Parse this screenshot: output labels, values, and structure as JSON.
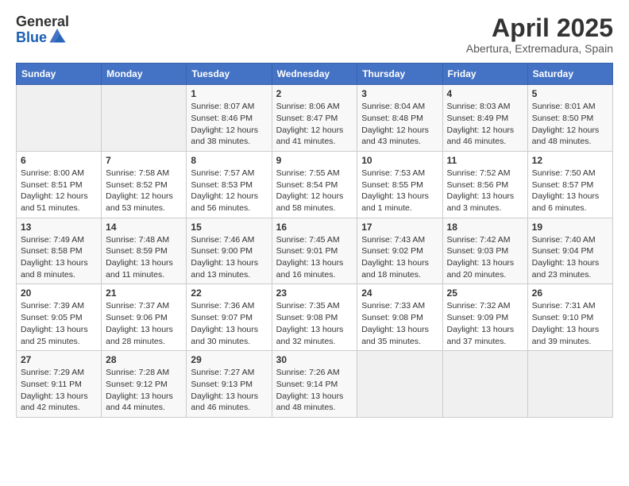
{
  "header": {
    "logo_general": "General",
    "logo_blue": "Blue",
    "month_title": "April 2025",
    "location": "Abertura, Extremadura, Spain"
  },
  "days_of_week": [
    "Sunday",
    "Monday",
    "Tuesday",
    "Wednesday",
    "Thursday",
    "Friday",
    "Saturday"
  ],
  "weeks": [
    [
      {
        "day": "",
        "sunrise": "",
        "sunset": "",
        "daylight": ""
      },
      {
        "day": "",
        "sunrise": "",
        "sunset": "",
        "daylight": ""
      },
      {
        "day": "1",
        "sunrise": "Sunrise: 8:07 AM",
        "sunset": "Sunset: 8:46 PM",
        "daylight": "Daylight: 12 hours and 38 minutes."
      },
      {
        "day": "2",
        "sunrise": "Sunrise: 8:06 AM",
        "sunset": "Sunset: 8:47 PM",
        "daylight": "Daylight: 12 hours and 41 minutes."
      },
      {
        "day": "3",
        "sunrise": "Sunrise: 8:04 AM",
        "sunset": "Sunset: 8:48 PM",
        "daylight": "Daylight: 12 hours and 43 minutes."
      },
      {
        "day": "4",
        "sunrise": "Sunrise: 8:03 AM",
        "sunset": "Sunset: 8:49 PM",
        "daylight": "Daylight: 12 hours and 46 minutes."
      },
      {
        "day": "5",
        "sunrise": "Sunrise: 8:01 AM",
        "sunset": "Sunset: 8:50 PM",
        "daylight": "Daylight: 12 hours and 48 minutes."
      }
    ],
    [
      {
        "day": "6",
        "sunrise": "Sunrise: 8:00 AM",
        "sunset": "Sunset: 8:51 PM",
        "daylight": "Daylight: 12 hours and 51 minutes."
      },
      {
        "day": "7",
        "sunrise": "Sunrise: 7:58 AM",
        "sunset": "Sunset: 8:52 PM",
        "daylight": "Daylight: 12 hours and 53 minutes."
      },
      {
        "day": "8",
        "sunrise": "Sunrise: 7:57 AM",
        "sunset": "Sunset: 8:53 PM",
        "daylight": "Daylight: 12 hours and 56 minutes."
      },
      {
        "day": "9",
        "sunrise": "Sunrise: 7:55 AM",
        "sunset": "Sunset: 8:54 PM",
        "daylight": "Daylight: 12 hours and 58 minutes."
      },
      {
        "day": "10",
        "sunrise": "Sunrise: 7:53 AM",
        "sunset": "Sunset: 8:55 PM",
        "daylight": "Daylight: 13 hours and 1 minute."
      },
      {
        "day": "11",
        "sunrise": "Sunrise: 7:52 AM",
        "sunset": "Sunset: 8:56 PM",
        "daylight": "Daylight: 13 hours and 3 minutes."
      },
      {
        "day": "12",
        "sunrise": "Sunrise: 7:50 AM",
        "sunset": "Sunset: 8:57 PM",
        "daylight": "Daylight: 13 hours and 6 minutes."
      }
    ],
    [
      {
        "day": "13",
        "sunrise": "Sunrise: 7:49 AM",
        "sunset": "Sunset: 8:58 PM",
        "daylight": "Daylight: 13 hours and 8 minutes."
      },
      {
        "day": "14",
        "sunrise": "Sunrise: 7:48 AM",
        "sunset": "Sunset: 8:59 PM",
        "daylight": "Daylight: 13 hours and 11 minutes."
      },
      {
        "day": "15",
        "sunrise": "Sunrise: 7:46 AM",
        "sunset": "Sunset: 9:00 PM",
        "daylight": "Daylight: 13 hours and 13 minutes."
      },
      {
        "day": "16",
        "sunrise": "Sunrise: 7:45 AM",
        "sunset": "Sunset: 9:01 PM",
        "daylight": "Daylight: 13 hours and 16 minutes."
      },
      {
        "day": "17",
        "sunrise": "Sunrise: 7:43 AM",
        "sunset": "Sunset: 9:02 PM",
        "daylight": "Daylight: 13 hours and 18 minutes."
      },
      {
        "day": "18",
        "sunrise": "Sunrise: 7:42 AM",
        "sunset": "Sunset: 9:03 PM",
        "daylight": "Daylight: 13 hours and 20 minutes."
      },
      {
        "day": "19",
        "sunrise": "Sunrise: 7:40 AM",
        "sunset": "Sunset: 9:04 PM",
        "daylight": "Daylight: 13 hours and 23 minutes."
      }
    ],
    [
      {
        "day": "20",
        "sunrise": "Sunrise: 7:39 AM",
        "sunset": "Sunset: 9:05 PM",
        "daylight": "Daylight: 13 hours and 25 minutes."
      },
      {
        "day": "21",
        "sunrise": "Sunrise: 7:37 AM",
        "sunset": "Sunset: 9:06 PM",
        "daylight": "Daylight: 13 hours and 28 minutes."
      },
      {
        "day": "22",
        "sunrise": "Sunrise: 7:36 AM",
        "sunset": "Sunset: 9:07 PM",
        "daylight": "Daylight: 13 hours and 30 minutes."
      },
      {
        "day": "23",
        "sunrise": "Sunrise: 7:35 AM",
        "sunset": "Sunset: 9:08 PM",
        "daylight": "Daylight: 13 hours and 32 minutes."
      },
      {
        "day": "24",
        "sunrise": "Sunrise: 7:33 AM",
        "sunset": "Sunset: 9:08 PM",
        "daylight": "Daylight: 13 hours and 35 minutes."
      },
      {
        "day": "25",
        "sunrise": "Sunrise: 7:32 AM",
        "sunset": "Sunset: 9:09 PM",
        "daylight": "Daylight: 13 hours and 37 minutes."
      },
      {
        "day": "26",
        "sunrise": "Sunrise: 7:31 AM",
        "sunset": "Sunset: 9:10 PM",
        "daylight": "Daylight: 13 hours and 39 minutes."
      }
    ],
    [
      {
        "day": "27",
        "sunrise": "Sunrise: 7:29 AM",
        "sunset": "Sunset: 9:11 PM",
        "daylight": "Daylight: 13 hours and 42 minutes."
      },
      {
        "day": "28",
        "sunrise": "Sunrise: 7:28 AM",
        "sunset": "Sunset: 9:12 PM",
        "daylight": "Daylight: 13 hours and 44 minutes."
      },
      {
        "day": "29",
        "sunrise": "Sunrise: 7:27 AM",
        "sunset": "Sunset: 9:13 PM",
        "daylight": "Daylight: 13 hours and 46 minutes."
      },
      {
        "day": "30",
        "sunrise": "Sunrise: 7:26 AM",
        "sunset": "Sunset: 9:14 PM",
        "daylight": "Daylight: 13 hours and 48 minutes."
      },
      {
        "day": "",
        "sunrise": "",
        "sunset": "",
        "daylight": ""
      },
      {
        "day": "",
        "sunrise": "",
        "sunset": "",
        "daylight": ""
      },
      {
        "day": "",
        "sunrise": "",
        "sunset": "",
        "daylight": ""
      }
    ]
  ]
}
